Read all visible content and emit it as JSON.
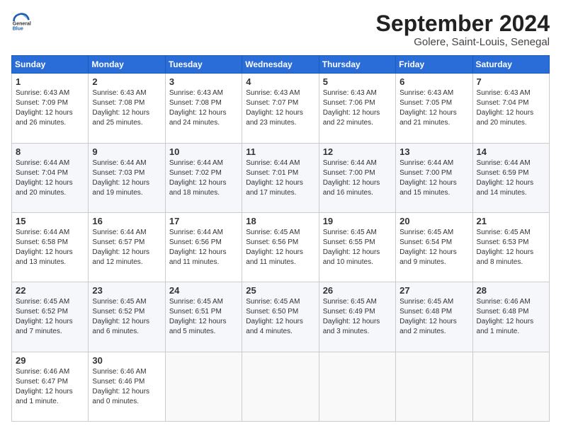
{
  "logo": {
    "line1": "General",
    "line2": "Blue"
  },
  "header": {
    "title": "September 2024",
    "subtitle": "Golere, Saint-Louis, Senegal"
  },
  "weekdays": [
    "Sunday",
    "Monday",
    "Tuesday",
    "Wednesday",
    "Thursday",
    "Friday",
    "Saturday"
  ],
  "weeks": [
    [
      {
        "day": "1",
        "info": "Sunrise: 6:43 AM\nSunset: 7:09 PM\nDaylight: 12 hours\nand 26 minutes."
      },
      {
        "day": "2",
        "info": "Sunrise: 6:43 AM\nSunset: 7:08 PM\nDaylight: 12 hours\nand 25 minutes."
      },
      {
        "day": "3",
        "info": "Sunrise: 6:43 AM\nSunset: 7:08 PM\nDaylight: 12 hours\nand 24 minutes."
      },
      {
        "day": "4",
        "info": "Sunrise: 6:43 AM\nSunset: 7:07 PM\nDaylight: 12 hours\nand 23 minutes."
      },
      {
        "day": "5",
        "info": "Sunrise: 6:43 AM\nSunset: 7:06 PM\nDaylight: 12 hours\nand 22 minutes."
      },
      {
        "day": "6",
        "info": "Sunrise: 6:43 AM\nSunset: 7:05 PM\nDaylight: 12 hours\nand 21 minutes."
      },
      {
        "day": "7",
        "info": "Sunrise: 6:43 AM\nSunset: 7:04 PM\nDaylight: 12 hours\nand 20 minutes."
      }
    ],
    [
      {
        "day": "8",
        "info": "Sunrise: 6:44 AM\nSunset: 7:04 PM\nDaylight: 12 hours\nand 20 minutes."
      },
      {
        "day": "9",
        "info": "Sunrise: 6:44 AM\nSunset: 7:03 PM\nDaylight: 12 hours\nand 19 minutes."
      },
      {
        "day": "10",
        "info": "Sunrise: 6:44 AM\nSunset: 7:02 PM\nDaylight: 12 hours\nand 18 minutes."
      },
      {
        "day": "11",
        "info": "Sunrise: 6:44 AM\nSunset: 7:01 PM\nDaylight: 12 hours\nand 17 minutes."
      },
      {
        "day": "12",
        "info": "Sunrise: 6:44 AM\nSunset: 7:00 PM\nDaylight: 12 hours\nand 16 minutes."
      },
      {
        "day": "13",
        "info": "Sunrise: 6:44 AM\nSunset: 7:00 PM\nDaylight: 12 hours\nand 15 minutes."
      },
      {
        "day": "14",
        "info": "Sunrise: 6:44 AM\nSunset: 6:59 PM\nDaylight: 12 hours\nand 14 minutes."
      }
    ],
    [
      {
        "day": "15",
        "info": "Sunrise: 6:44 AM\nSunset: 6:58 PM\nDaylight: 12 hours\nand 13 minutes."
      },
      {
        "day": "16",
        "info": "Sunrise: 6:44 AM\nSunset: 6:57 PM\nDaylight: 12 hours\nand 12 minutes."
      },
      {
        "day": "17",
        "info": "Sunrise: 6:44 AM\nSunset: 6:56 PM\nDaylight: 12 hours\nand 11 minutes."
      },
      {
        "day": "18",
        "info": "Sunrise: 6:45 AM\nSunset: 6:56 PM\nDaylight: 12 hours\nand 11 minutes."
      },
      {
        "day": "19",
        "info": "Sunrise: 6:45 AM\nSunset: 6:55 PM\nDaylight: 12 hours\nand 10 minutes."
      },
      {
        "day": "20",
        "info": "Sunrise: 6:45 AM\nSunset: 6:54 PM\nDaylight: 12 hours\nand 9 minutes."
      },
      {
        "day": "21",
        "info": "Sunrise: 6:45 AM\nSunset: 6:53 PM\nDaylight: 12 hours\nand 8 minutes."
      }
    ],
    [
      {
        "day": "22",
        "info": "Sunrise: 6:45 AM\nSunset: 6:52 PM\nDaylight: 12 hours\nand 7 minutes."
      },
      {
        "day": "23",
        "info": "Sunrise: 6:45 AM\nSunset: 6:52 PM\nDaylight: 12 hours\nand 6 minutes."
      },
      {
        "day": "24",
        "info": "Sunrise: 6:45 AM\nSunset: 6:51 PM\nDaylight: 12 hours\nand 5 minutes."
      },
      {
        "day": "25",
        "info": "Sunrise: 6:45 AM\nSunset: 6:50 PM\nDaylight: 12 hours\nand 4 minutes."
      },
      {
        "day": "26",
        "info": "Sunrise: 6:45 AM\nSunset: 6:49 PM\nDaylight: 12 hours\nand 3 minutes."
      },
      {
        "day": "27",
        "info": "Sunrise: 6:45 AM\nSunset: 6:48 PM\nDaylight: 12 hours\nand 2 minutes."
      },
      {
        "day": "28",
        "info": "Sunrise: 6:46 AM\nSunset: 6:48 PM\nDaylight: 12 hours\nand 1 minute."
      }
    ],
    [
      {
        "day": "29",
        "info": "Sunrise: 6:46 AM\nSunset: 6:47 PM\nDaylight: 12 hours\nand 1 minute."
      },
      {
        "day": "30",
        "info": "Sunrise: 6:46 AM\nSunset: 6:46 PM\nDaylight: 12 hours\nand 0 minutes."
      },
      {
        "day": "",
        "info": ""
      },
      {
        "day": "",
        "info": ""
      },
      {
        "day": "",
        "info": ""
      },
      {
        "day": "",
        "info": ""
      },
      {
        "day": "",
        "info": ""
      }
    ]
  ]
}
